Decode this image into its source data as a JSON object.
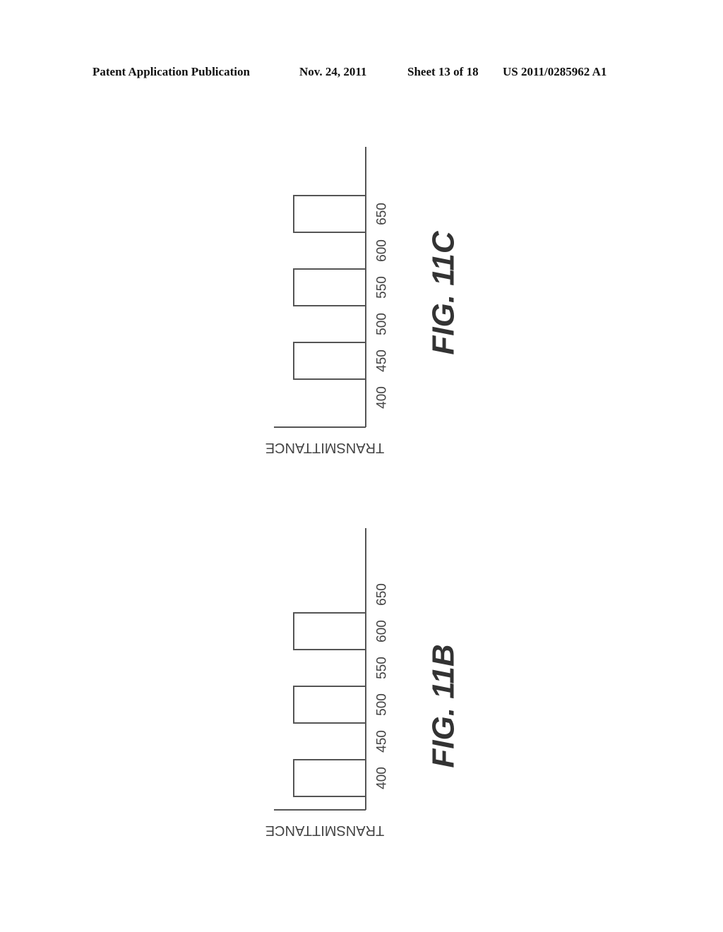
{
  "header": {
    "left": "Patent Application Publication",
    "date": "Nov. 24, 2011",
    "sheet": "Sheet 13 of 18",
    "number": "US 2011/0285962 A1"
  },
  "chart_data": [
    {
      "id": "fig11c",
      "type": "bar",
      "title": "FIG. 11C",
      "xlabel": "",
      "ylabel": "TRANSMITTANCE",
      "x_ticks": [
        400,
        450,
        500,
        550,
        600,
        650
      ],
      "xlim": [
        350,
        730
      ],
      "ylim": [
        0,
        1
      ],
      "grid": false,
      "orientation": "rotated-90",
      "passbands": [
        {
          "start": 425,
          "end": 475,
          "value": 1
        },
        {
          "start": 525,
          "end": 575,
          "value": 1
        },
        {
          "start": 625,
          "end": 675,
          "value": 1
        }
      ]
    },
    {
      "id": "fig11b",
      "type": "bar",
      "title": "FIG. 11B",
      "xlabel": "",
      "ylabel": "TRANSMITTANCE",
      "x_ticks": [
        400,
        450,
        500,
        550,
        600,
        650
      ],
      "xlim": [
        350,
        730
      ],
      "ylim": [
        0,
        1
      ],
      "grid": false,
      "orientation": "rotated-90",
      "passbands": [
        {
          "start": 375,
          "end": 425,
          "value": 1
        },
        {
          "start": 475,
          "end": 525,
          "value": 1
        },
        {
          "start": 575,
          "end": 625,
          "value": 1
        }
      ]
    }
  ]
}
